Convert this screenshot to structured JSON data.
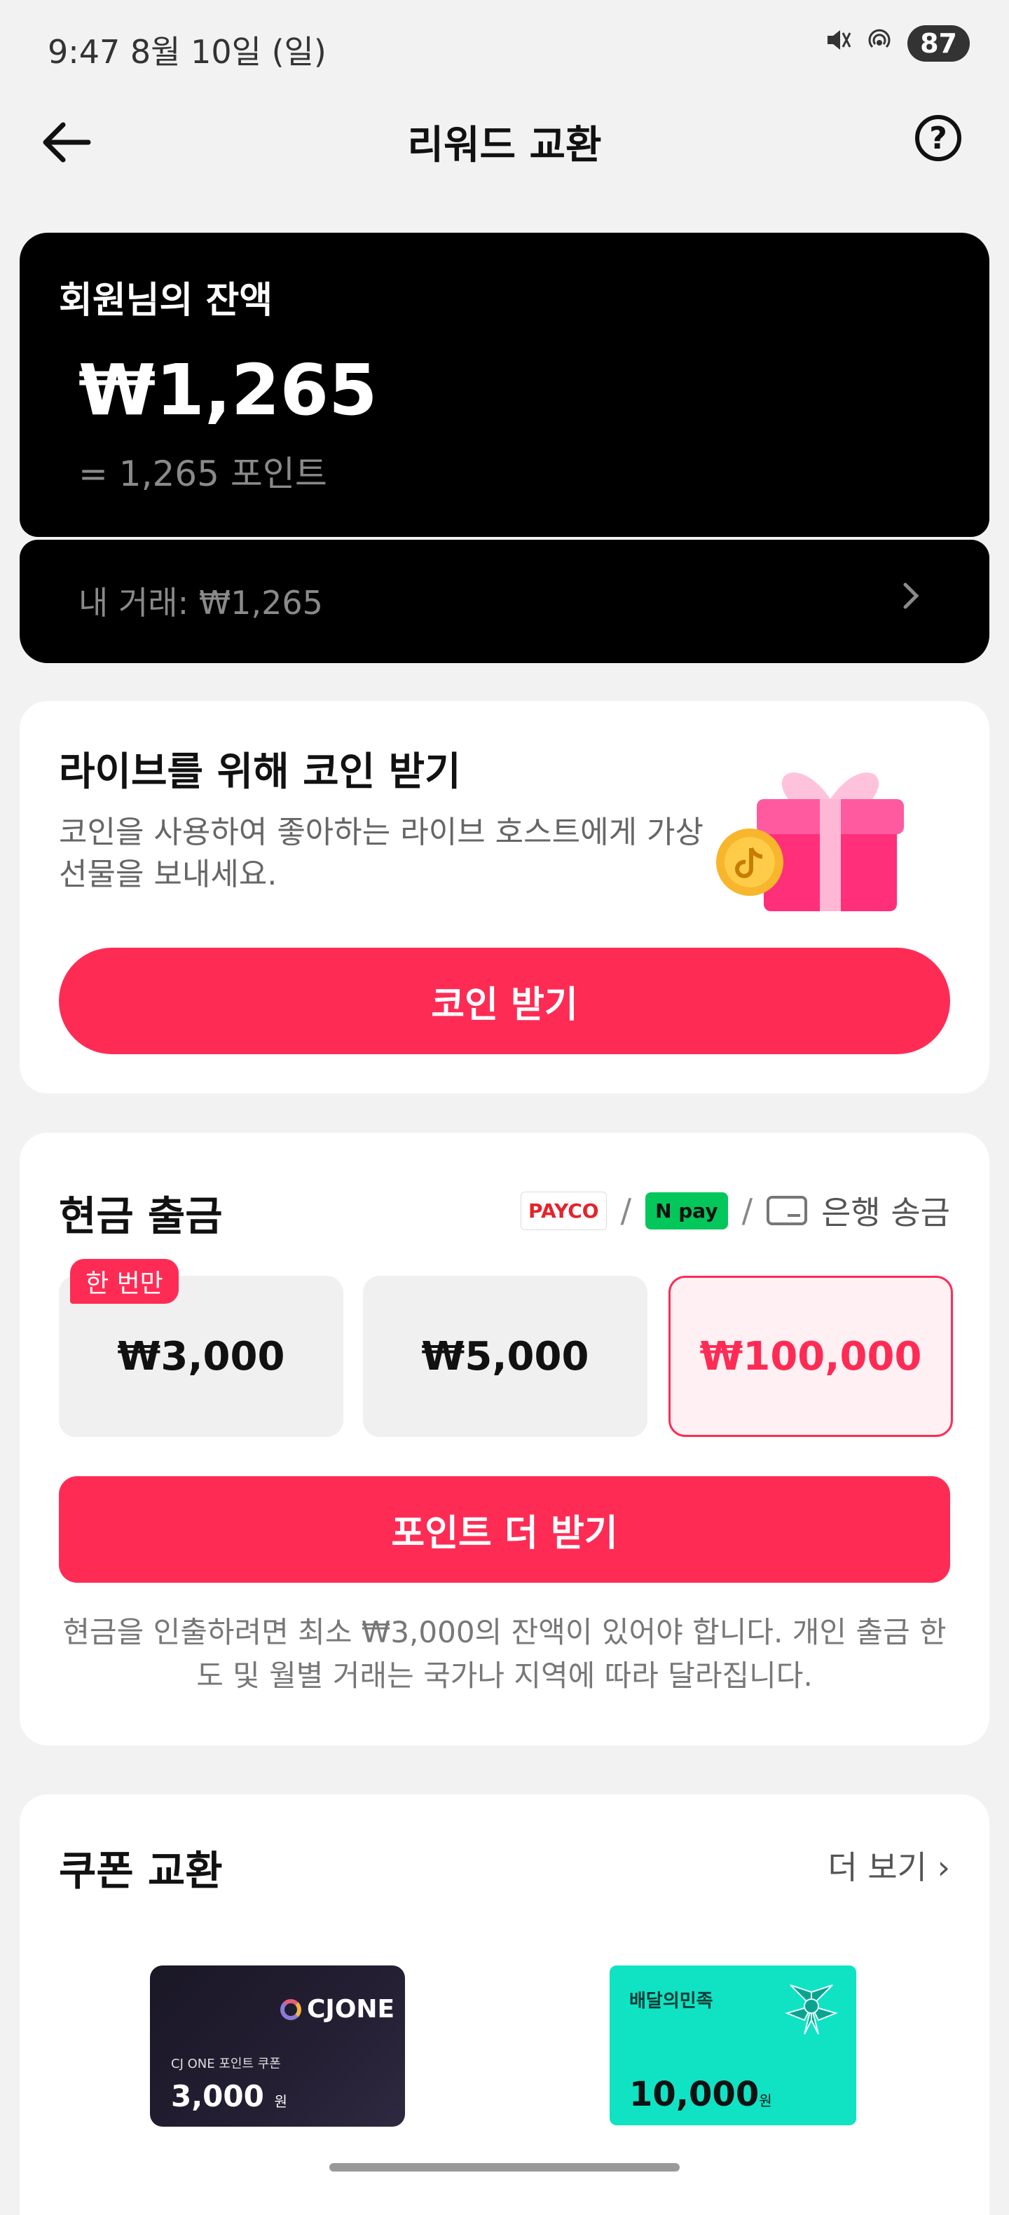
{
  "status_bar": {
    "time": "9:47  8월 10일 (일)",
    "battery": "87"
  },
  "header": {
    "title": "리워드 교환",
    "back_icon": "arrow-left-icon",
    "help_icon": "question-circle-icon",
    "help_glyph": "?"
  },
  "balance": {
    "label": "회원님의 잔액",
    "amount": "₩1,265",
    "points": "= 1,265 포인트",
    "transactions": "내 거래: ₩1,265"
  },
  "coin_section": {
    "title": "라이브를 위해 코인 받기",
    "description": "코인을 사용하여 좋아하는 라이브 호스트에게 가상 선물을 보내세요.",
    "button": "코인 받기"
  },
  "cashout": {
    "title": "현금 출금",
    "methods": {
      "payco": "PAYCO",
      "npay": "pay",
      "npay_badge": "N",
      "bank": "은행 송금",
      "separator": "/"
    },
    "once_badge": "한 번만",
    "amounts": [
      "₩3,000",
      "₩5,000",
      "₩100,000"
    ],
    "button": "포인트 더 받기",
    "note": "현금을 인출하려면 최소 ₩3,000의 잔액이 있어야 합니다. 개인 출금 한도 및 월별 거래는 국가나 지역에 따라 달라집니다."
  },
  "coupons": {
    "title": "쿠폰 교환",
    "more": "더 보기 ›",
    "items": [
      {
        "brand": "CJONE",
        "subtitle": "CJ ONE 포인트 쿠폰",
        "amount": "3,000",
        "unit": "원"
      },
      {
        "brand": "배달의민족",
        "amount": "10,000",
        "unit": "원"
      }
    ]
  },
  "colors": {
    "accent": "#fe2c55",
    "card_dark": "#000000",
    "baemin": "#0fe3c4"
  }
}
